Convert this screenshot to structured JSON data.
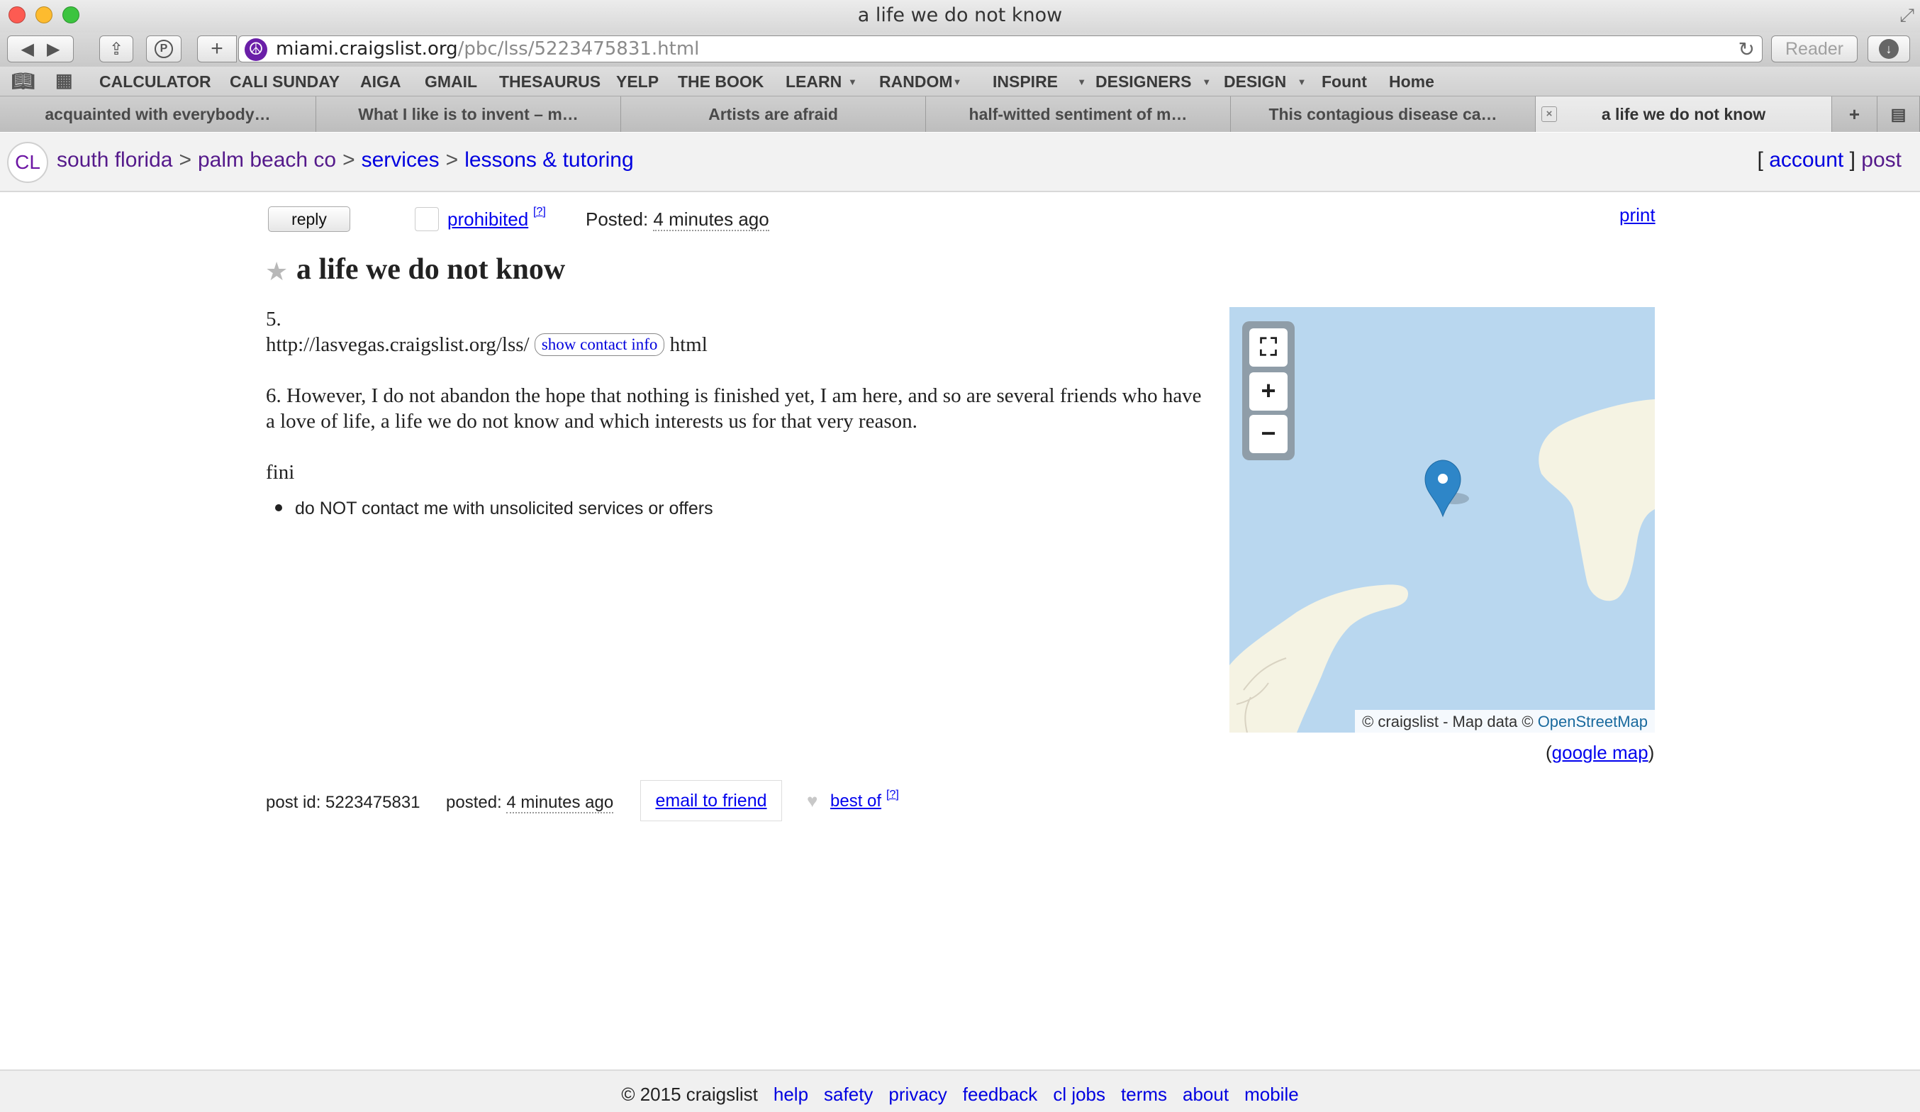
{
  "window": {
    "title": "a life we do not know"
  },
  "toolbar": {
    "address_host": "miami.craigslist.org",
    "address_path": "/pbc/lss/5223475831.html",
    "reader_label": "Reader"
  },
  "bookmarks": [
    {
      "label": "CALCULATOR",
      "menu": false
    },
    {
      "label": "CALI SUNDAY",
      "menu": false
    },
    {
      "label": "AIGA",
      "menu": false
    },
    {
      "label": "GMAIL",
      "menu": false
    },
    {
      "label": "THESAURUS",
      "menu": false
    },
    {
      "label": "YELP",
      "menu": false
    },
    {
      "label": "THE BOOK",
      "menu": false
    },
    {
      "label": "LEARN",
      "menu": true
    },
    {
      "label": "RANDOM",
      "menu": true
    },
    {
      "label": "INSPIRE",
      "menu": true
    },
    {
      "label": "DESIGNERS",
      "menu": true
    },
    {
      "label": "DESIGN",
      "menu": true
    },
    {
      "label": "Fount",
      "menu": false
    },
    {
      "label": "Home",
      "menu": false
    }
  ],
  "tabs": [
    {
      "label": "acquainted with everybody…",
      "active": false
    },
    {
      "label": "What I like is to invent – m…",
      "active": false
    },
    {
      "label": "Artists are afraid",
      "active": false
    },
    {
      "label": "half-witted sentiment of m…",
      "active": false
    },
    {
      "label": "This contagious disease ca…",
      "active": false
    },
    {
      "label": "a life we do not know",
      "active": true
    }
  ],
  "header": {
    "logo": "CL",
    "breadcrumbs": [
      "south florida",
      "palm beach co",
      "services",
      "lessons & tutoring"
    ],
    "breadcrumb_sep": ">",
    "account_label": "account",
    "post_label": "post"
  },
  "posting": {
    "reply_label": "reply",
    "prohibited_label": "prohibited",
    "help_sup": "[?]",
    "posted_prefix": "Posted: ",
    "posted_time": "4 minutes ago",
    "print_label": "print",
    "title": "a life we do not know",
    "p5": "5.",
    "url_text": "http://lasvegas.craigslist.org/lss/",
    "contact_label": "show contact info",
    "url_suffix": " html",
    "p6": "6. However, I do not abandon the hope that nothing is finished yet, I am here, and so are several friends who have a love of life, a life we do not know and which interests us for that very reason.",
    "fini": "fini",
    "notice": "do NOT contact me with unsolicited services or offers"
  },
  "map": {
    "fullscreen_icon": "⛶",
    "zoom_in": "+",
    "zoom_out": "−",
    "attribution_prefix": "© craigslist - Map data © ",
    "attribution_link": "OpenStreetMap",
    "google_open": "(",
    "google_map_label": "google map",
    "google_close": ")",
    "water_color": "#b9d7ef",
    "land_color": "#f5f3e3"
  },
  "post_footer": {
    "post_id_label": "post id: 5223475831",
    "posted_prefix": "posted: ",
    "posted_time": "4 minutes ago",
    "email_label": "email to friend",
    "best_of_label": "best of",
    "help_sup": "[?]"
  },
  "footer": {
    "copyright": "© 2015 craigslist",
    "links": [
      "help",
      "safety",
      "privacy",
      "feedback",
      "cl jobs",
      "terms",
      "about",
      "mobile"
    ]
  }
}
